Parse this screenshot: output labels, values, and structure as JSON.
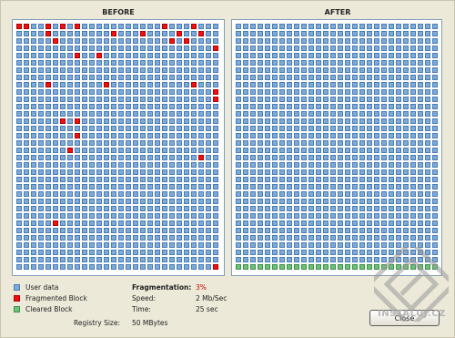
{
  "panels": {
    "before_title": "BEFORE",
    "after_title": "AFTER"
  },
  "grid": {
    "before": {
      "cols": 28,
      "rows": 34,
      "fragmented_cells": [
        [
          0,
          0
        ],
        [
          1,
          0
        ],
        [
          4,
          0
        ],
        [
          6,
          0
        ],
        [
          8,
          0
        ],
        [
          20,
          0
        ],
        [
          24,
          0
        ],
        [
          4,
          1
        ],
        [
          13,
          1
        ],
        [
          17,
          1
        ],
        [
          22,
          1
        ],
        [
          25,
          1
        ],
        [
          5,
          2
        ],
        [
          21,
          2
        ],
        [
          23,
          2
        ],
        [
          27,
          3
        ],
        [
          8,
          4
        ],
        [
          11,
          4
        ],
        [
          4,
          8
        ],
        [
          12,
          8
        ],
        [
          24,
          8
        ],
        [
          27,
          9
        ],
        [
          27,
          10
        ],
        [
          6,
          13
        ],
        [
          8,
          13
        ],
        [
          8,
          15
        ],
        [
          7,
          17
        ],
        [
          25,
          18
        ],
        [
          5,
          27
        ],
        [
          27,
          33
        ]
      ]
    },
    "after": {
      "cols": 28,
      "rows": 34,
      "cleared_rows": [
        33
      ]
    }
  },
  "legend": {
    "user_data": "User data",
    "fragmented": "Fragmented Block",
    "cleared": "Cleared Block",
    "colors": {
      "user_data": "#7eaad8",
      "fragmented": "#ee1111",
      "cleared": "#6fc07a"
    }
  },
  "stats": {
    "fragmentation_label": "Fragmentation:",
    "fragmentation_value": "3%",
    "speed_label": "Speed:",
    "speed_value": "2 Mb/Sec",
    "time_label": "Time:",
    "time_value": "25 sec",
    "registry_size_label": "Registry Size:",
    "registry_size_value": "50 MBytes"
  },
  "buttons": {
    "close_label": "Close"
  },
  "watermark": {
    "text": "INSTALUJ.CZ"
  }
}
